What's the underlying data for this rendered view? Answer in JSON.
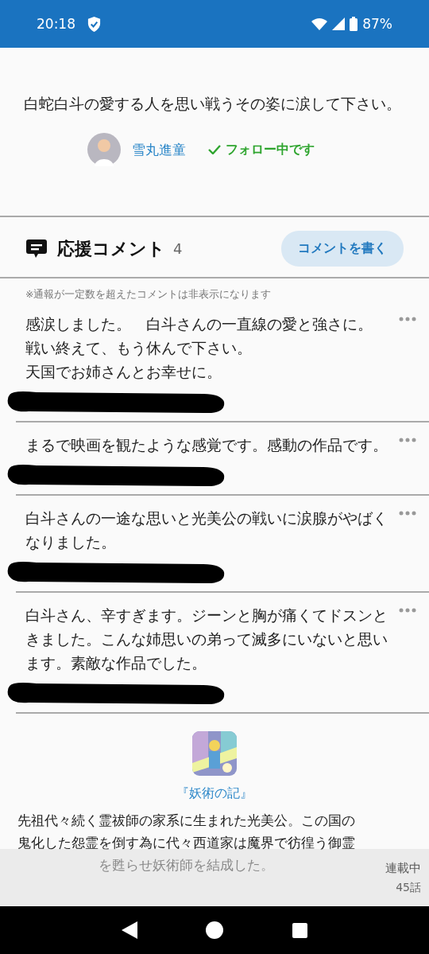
{
  "status_bar": {
    "time": "20:18",
    "battery": "87%"
  },
  "intro": "白蛇白斗の愛する人を思い戦うその姿に涙して下さい。",
  "author": {
    "name": "雪丸進童",
    "follow_label": "フォロー中です",
    "following": true
  },
  "comments_header": {
    "title": "応援コメント",
    "count": "4",
    "write_button": "コメントを書く"
  },
  "notice": "※通報が一定数を超えたコメントは非表示になります",
  "comments": [
    {
      "lines": [
        "感涙しました。　白斗さんの一直線の愛と強さに。",
        "戦い終えて、もう休んで下さい。",
        "天国でお姉さんとお幸せに。"
      ],
      "redacted": true
    },
    {
      "lines": [
        "まるで映画を観たような感覚です。感動の作品です。"
      ],
      "redacted": true
    },
    {
      "lines": [
        "白斗さんの一途な思いと光美公の戦いに涙腺がやばくなりました。"
      ],
      "redacted": true
    },
    {
      "lines": [
        "白斗さん、辛すぎます。ジーンと胸が痛くてドスンときました。こんな姉思いの弟って滅多にいないと思います。素敵な作品でした。"
      ],
      "redacted": true
    }
  ],
  "work": {
    "title": "『妖術の記』",
    "description": "先祖代々続く霊祓師の家系に生まれた光美公。この国の鬼化した怨霊を倒す為に代々西道家は魔界で彷徨う御霊を甦らせ妖術師を結成した。"
  },
  "bottom_bar": {
    "status": "連載中",
    "episodes": "45話"
  }
}
